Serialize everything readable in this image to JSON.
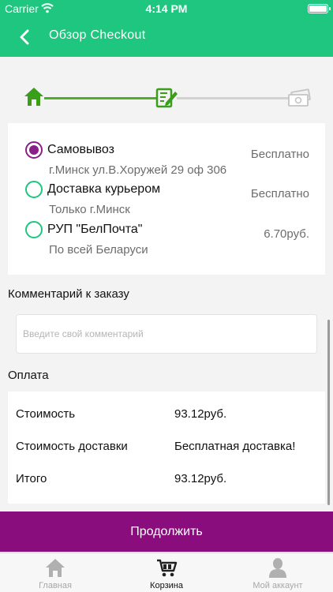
{
  "status_bar": {
    "carrier": "Carrier",
    "time": "4:14 PM"
  },
  "nav": {
    "title": "Обзор Checkout",
    "back_icon": "chevron-left-icon"
  },
  "colors": {
    "brand_green": "#1fc67f",
    "accent_purple": "#8a0d7d",
    "step_green": "#4caf25"
  },
  "stepper": {
    "steps": [
      {
        "icon": "home-icon",
        "state": "done"
      },
      {
        "icon": "edit-form-icon",
        "state": "current"
      },
      {
        "icon": "payment-money-icon",
        "state": "todo"
      }
    ]
  },
  "delivery": {
    "options": [
      {
        "name": "Самовывоз",
        "description": "г.Минск ул.В.Хоружей 29 оф 306",
        "price": "Бесплатно",
        "selected": true
      },
      {
        "name": "Доставка курьером",
        "description": "Только г.Минск",
        "price": "Бесплатно",
        "selected": false
      },
      {
        "name": "РУП \"БелПочта\"",
        "description": "По всей Беларуси",
        "price": "6.70руб.",
        "selected": false
      }
    ]
  },
  "comment": {
    "label": "Комментарий к заказу",
    "placeholder": "Введите свой комментарий",
    "value": ""
  },
  "payment": {
    "label": "Оплата",
    "rows": [
      {
        "key": "Стоимость",
        "value": "93.12руб."
      },
      {
        "key": "Стоимость доставки",
        "value": "Бесплатная доставка!"
      },
      {
        "key": "Итого",
        "value": "93.12руб."
      }
    ]
  },
  "continue_button": {
    "label": "Продолжить"
  },
  "tab_bar": {
    "tabs": [
      {
        "label": "Главная",
        "icon": "home-icon",
        "active": false
      },
      {
        "label": "Корзина",
        "icon": "cart-icon",
        "active": true
      },
      {
        "label": "Мой аккаунт",
        "icon": "user-icon",
        "active": false
      }
    ]
  }
}
